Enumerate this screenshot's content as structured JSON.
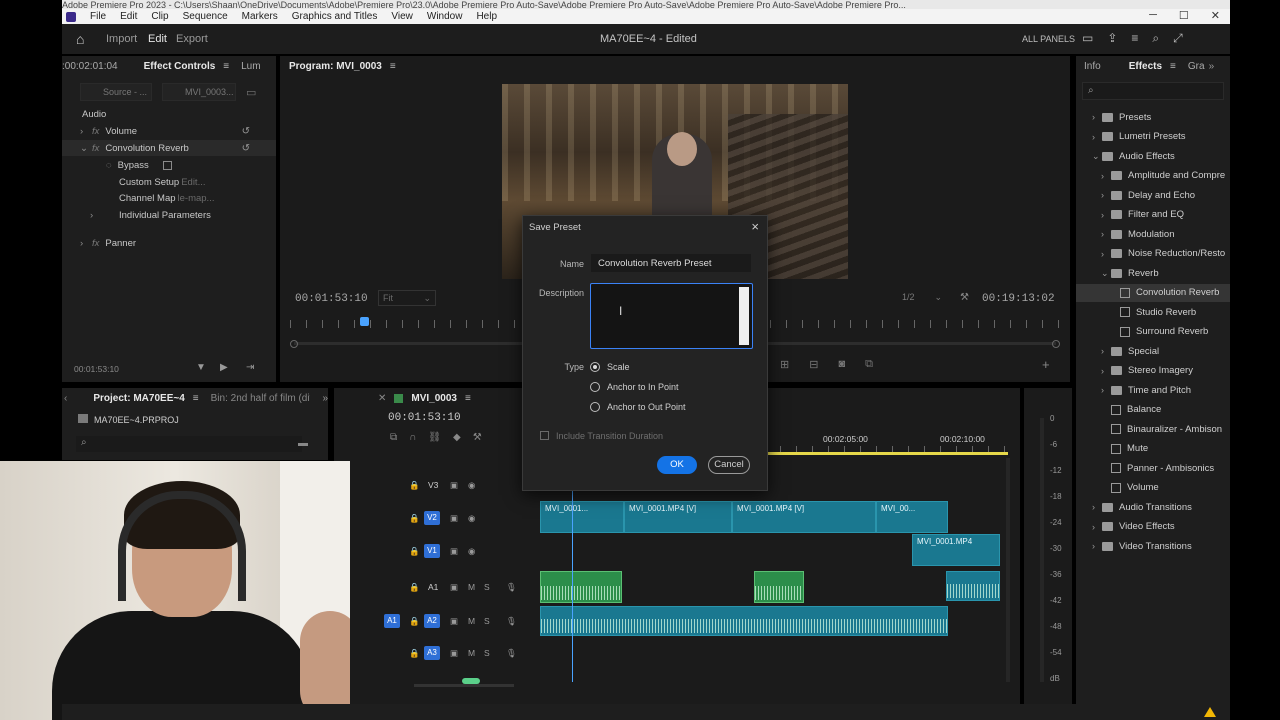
{
  "window": {
    "title": "Adobe Premiere Pro 2023 - C:\\Users\\Shaan\\OneDrive\\Documents\\Adobe\\Premiere Pro\\23.0\\Adobe Premiere Pro Auto-Save\\Adobe Premiere Pro Auto-Save\\Adobe Premiere Pro Auto-Save\\Adobe Premiere Pro..."
  },
  "menu": [
    "File",
    "Edit",
    "Clip",
    "Sequence",
    "Markers",
    "Graphics and Titles",
    "View",
    "Window",
    "Help"
  ],
  "header": {
    "tabs": [
      "Import",
      "Edit",
      "Export"
    ],
    "active_tab": "Edit",
    "project_title": "MA70EE~4 - Edited",
    "all_panels": "ALL PANELS"
  },
  "effect_controls": {
    "timecode_top": ":00:02:01:04",
    "tab_active": "Effect Controls",
    "tab_next": "Lum",
    "source": "Source - ...",
    "clip": "MVI_0003...",
    "section": "Audio",
    "rows": {
      "volume": "Volume",
      "convolution": "Convolution Reverb",
      "bypass": "Bypass",
      "custom_setup": "Custom Setup",
      "custom_setup_btn": "Edit...",
      "channel_map": "Channel Map",
      "channel_map_btn": "le-map...",
      "individual": "Individual Parameters",
      "panner": "Panner"
    },
    "timecode_bottom": "00:01:53:10"
  },
  "program": {
    "title": "Program: MVI_0003",
    "timecode_left": "00:01:53:10",
    "fit": "Fit",
    "quality": "1/2",
    "timecode_right": "00:19:13:02"
  },
  "project": {
    "tab_active": "Project: MA70EE~4",
    "bin": "Bin: 2nd half of film (diff c",
    "file": "MA70EE~4.PRPROJ"
  },
  "timeline": {
    "seq_name": "MVI_0003",
    "timecode": "00:01:53:10",
    "ruler": [
      "00:02:05:00",
      "00:02:10:00"
    ],
    "tracks": [
      "V3",
      "V2",
      "V1",
      "A1",
      "A2",
      "A3"
    ],
    "clips_v2": [
      "MVI_0001...",
      "MVI_0001.MP4 [V]",
      "MVI_0001.MP4 [V]",
      "MVI_00..."
    ],
    "clips_v1": [
      "MVI_0001.MP4"
    ]
  },
  "meter": {
    "ticks": [
      "0",
      "-6",
      "-12",
      "-18",
      "-24",
      "-30",
      "-36",
      "-42",
      "-48",
      "-54",
      "dB"
    ]
  },
  "effects": {
    "tab_info": "Info",
    "tab_active": "Effects",
    "tab_next": "Gra",
    "items": [
      {
        "label": "Presets",
        "level": 0,
        "type": "folder",
        "expanded": false
      },
      {
        "label": "Lumetri Presets",
        "level": 0,
        "type": "folder",
        "expanded": false
      },
      {
        "label": "Audio Effects",
        "level": 0,
        "type": "folder",
        "expanded": true
      },
      {
        "label": "Amplitude and Compre",
        "level": 1,
        "type": "folder",
        "expanded": false
      },
      {
        "label": "Delay and Echo",
        "level": 1,
        "type": "folder",
        "expanded": false
      },
      {
        "label": "Filter and EQ",
        "level": 1,
        "type": "folder",
        "expanded": false
      },
      {
        "label": "Modulation",
        "level": 1,
        "type": "folder",
        "expanded": false
      },
      {
        "label": "Noise Reduction/Resto",
        "level": 1,
        "type": "folder",
        "expanded": false
      },
      {
        "label": "Reverb",
        "level": 1,
        "type": "folder",
        "expanded": true
      },
      {
        "label": "Convolution Reverb",
        "level": 2,
        "type": "effect",
        "selected": true
      },
      {
        "label": "Studio Reverb",
        "level": 2,
        "type": "effect"
      },
      {
        "label": "Surround Reverb",
        "level": 2,
        "type": "effect"
      },
      {
        "label": "Special",
        "level": 1,
        "type": "folder",
        "expanded": false
      },
      {
        "label": "Stereo Imagery",
        "level": 1,
        "type": "folder",
        "expanded": false
      },
      {
        "label": "Time and Pitch",
        "level": 1,
        "type": "folder",
        "expanded": false
      },
      {
        "label": "Balance",
        "level": 1,
        "type": "effect"
      },
      {
        "label": "Binauralizer - Ambison",
        "level": 1,
        "type": "effect"
      },
      {
        "label": "Mute",
        "level": 1,
        "type": "effect"
      },
      {
        "label": "Panner - Ambisonics",
        "level": 1,
        "type": "effect"
      },
      {
        "label": "Volume",
        "level": 1,
        "type": "effect"
      },
      {
        "label": "Audio Transitions",
        "level": 0,
        "type": "folder",
        "expanded": false
      },
      {
        "label": "Video Effects",
        "level": 0,
        "type": "folder",
        "expanded": false
      },
      {
        "label": "Video Transitions",
        "level": 0,
        "type": "folder",
        "expanded": false
      }
    ]
  },
  "dialog": {
    "title": "Save Preset",
    "name_label": "Name",
    "name_value": "Convolution Reverb Preset",
    "description_label": "Description",
    "type_label": "Type",
    "options": [
      "Scale",
      "Anchor to In Point",
      "Anchor to Out Point"
    ],
    "selected_option": "Scale",
    "include_transition": "Include Transition Duration",
    "ok": "OK",
    "cancel": "Cancel"
  },
  "colors": {
    "accent": "#1473e6",
    "video_clip": "#1a7890",
    "audio_clip": "#2c8e4a",
    "track_badge": "#2f6fd6",
    "playhead": "#4aa3ff",
    "workarea": "#e6d84a"
  }
}
